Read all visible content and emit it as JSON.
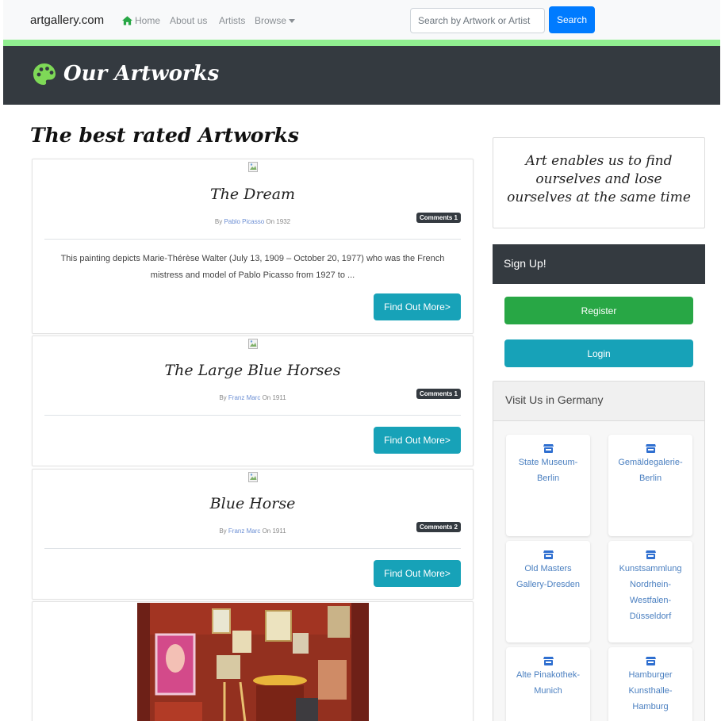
{
  "nav": {
    "brand": "artgallery.com",
    "home": "Home",
    "about": "About us",
    "artists": "Artists",
    "browse": "Browse",
    "search_placeholder": "Search by Artwork or Artist",
    "search_button": "Search"
  },
  "banner": {
    "title": "Our Artworks"
  },
  "main": {
    "heading": "The best rated Artworks",
    "artworks": [
      {
        "title": "The Dream",
        "by": "By",
        "artist": "Pablo Picasso",
        "on": "On 1932",
        "comments": "Comments 1",
        "excerpt": "This painting depicts Marie-Thérèse Walter (July 13, 1909 – October 20, 1977) who was the French mistress and model of Pablo Picasso from 1927 to ...",
        "button": "Find Out More>"
      },
      {
        "title": "The Large Blue Horses",
        "by": "By",
        "artist": "Franz Marc",
        "on": "On 1911",
        "comments": "Comments 1",
        "button": "Find Out More>"
      },
      {
        "title": "Blue Horse",
        "by": "By",
        "artist": "Franz Marc",
        "on": "On 1911",
        "comments": "Comments 2",
        "button": "Find Out More>"
      }
    ]
  },
  "sidebar": {
    "quote": "Art enables us to find ourselves and lose ourselves at the same time",
    "signup": "Sign Up!",
    "register": "Register",
    "login": "Login",
    "visit_title": "Visit Us in Germany",
    "galleries": [
      "State Museum-Berlin",
      "Gemäldegalerie-Berlin",
      "Old Masters Gallery-Dresden",
      "Kunstsammlung Nordrhein-Westfalen-Düsseldorf",
      "Alte Pinakothek-Munich",
      "Hamburger Kunsthalle-Hamburg"
    ]
  },
  "colors": {
    "nav_bg": "#f8f9fa",
    "accent_strip": "#90ee90",
    "banner_bg": "#343a40",
    "primary": "#007bff",
    "info": "#17a2b8",
    "success": "#28a745",
    "link": "#4a7fc0"
  },
  "icons": {
    "home": "home-icon",
    "brand": "palette-icon",
    "gallery": "building-icon",
    "broken_image": "broken-image-icon"
  }
}
